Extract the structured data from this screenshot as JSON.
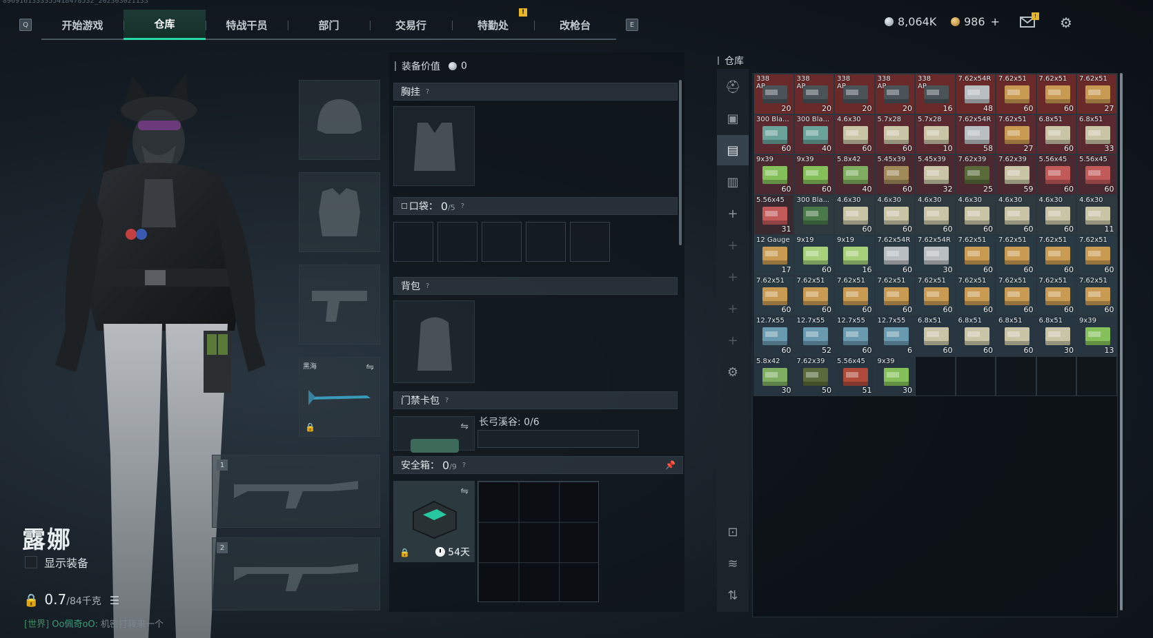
{
  "nav": {
    "key_left": "Q",
    "key_right": "E",
    "tabs": [
      {
        "label": "开始游戏",
        "active": false,
        "alert": false
      },
      {
        "label": "仓库",
        "active": true,
        "alert": false
      },
      {
        "label": "特战干员",
        "active": false,
        "alert": false
      },
      {
        "label": "部门",
        "active": false,
        "alert": false
      },
      {
        "label": "交易行",
        "active": false,
        "alert": false
      },
      {
        "label": "特勤处",
        "active": false,
        "alert": true
      },
      {
        "label": "改枪台",
        "active": false,
        "alert": false
      }
    ],
    "alert_mark": "!"
  },
  "currency": {
    "silver": "8,064K",
    "gold": "986",
    "gold_add": "+"
  },
  "character": {
    "name": "露娜",
    "show_gear_label": "显示装备",
    "weight_current": "0.7",
    "weight_cap": "/84千克"
  },
  "chat": {
    "channel": "[世界]",
    "user": "Oo佩奇oO:",
    "message": "机密打转来一个"
  },
  "gear": {
    "sidearm_name": "黑海",
    "primary_1": "1",
    "primary_2": "2"
  },
  "equipment": {
    "value_label": "装备价值",
    "value": "0",
    "chest_rig": "胸挂",
    "pockets_label": "口袋：",
    "pockets_used": "0",
    "pockets_cap": "/5",
    "backpack": "背包",
    "keycard": "门禁卡包",
    "keycard_info": "长弓溪谷: 0/6",
    "safe_label": "安全箱：",
    "safe_used": "0",
    "safe_cap": "/9",
    "safe_days": "54天",
    "help": "?"
  },
  "warehouse": {
    "title": "仓库",
    "items": [
      {
        "name": "338",
        "sub": "AP",
        "qty": "20",
        "color": "#6a2a2a",
        "box": "#4a5358"
      },
      {
        "name": "338",
        "sub": "AP",
        "qty": "20",
        "color": "#6a2a2a",
        "box": "#4a5358"
      },
      {
        "name": "338",
        "sub": "AP",
        "qty": "20",
        "color": "#6a2a2a",
        "box": "#4a5358"
      },
      {
        "name": "338",
        "sub": "AP",
        "qty": "20",
        "color": "#6a2a2a",
        "box": "#4a5358"
      },
      {
        "name": "338",
        "sub": "AP",
        "qty": "16",
        "color": "#6a2a2a",
        "box": "#4a5358"
      },
      {
        "name": "7.62x54R",
        "sub": "",
        "qty": "48",
        "color": "#6a2a2a",
        "box": "#b9bec2"
      },
      {
        "name": "7.62x51",
        "sub": "",
        "qty": "60",
        "color": "#6a2a2a",
        "box": "#c89a52"
      },
      {
        "name": "7.62x51",
        "sub": "",
        "qty": "60",
        "color": "#6a2a2a",
        "box": "#c89a52"
      },
      {
        "name": "7.62x51",
        "sub": "",
        "qty": "27",
        "color": "#6a2a2a",
        "box": "#c89a52"
      },
      {
        "name": "300 Bla...",
        "sub": "",
        "qty": "60",
        "color": "#5a2a30",
        "box": "#6aa39a"
      },
      {
        "name": "300 Bla...",
        "sub": "",
        "qty": "40",
        "color": "#5a2a30",
        "box": "#6aa39a"
      },
      {
        "name": "4.6x30",
        "sub": "",
        "qty": "60",
        "color": "#5a2a30",
        "box": "#c9c4a6"
      },
      {
        "name": "5.7x28",
        "sub": "",
        "qty": "60",
        "color": "#5a2a30",
        "box": "#c9c4a6"
      },
      {
        "name": "5.7x28",
        "sub": "",
        "qty": "10",
        "color": "#5a2a30",
        "box": "#c9c4a6"
      },
      {
        "name": "7.62x54R",
        "sub": "",
        "qty": "58",
        "color": "#5a2a30",
        "box": "#b9bec2"
      },
      {
        "name": "7.62x51",
        "sub": "",
        "qty": "27",
        "color": "#5a2a30",
        "box": "#c89a52"
      },
      {
        "name": "6.8x51",
        "sub": "",
        "qty": "60",
        "color": "#5a2a30",
        "box": "#c9c4a6"
      },
      {
        "name": "6.8x51",
        "sub": "",
        "qty": "33",
        "color": "#5a2a30",
        "box": "#c9c4a6"
      },
      {
        "name": "9x39",
        "sub": "",
        "qty": "60",
        "color": "#4a2a30",
        "box": "#86c05a"
      },
      {
        "name": "9x39",
        "sub": "",
        "qty": "60",
        "color": "#4a2a30",
        "box": "#86c05a"
      },
      {
        "name": "5.8x42",
        "sub": "",
        "qty": "40",
        "color": "#4a2a30",
        "box": "#7fae62"
      },
      {
        "name": "5.45x39",
        "sub": "",
        "qty": "60",
        "color": "#4a2a30",
        "box": "#a08a5a"
      },
      {
        "name": "5.45x39",
        "sub": "",
        "qty": "32",
        "color": "#4a2a30",
        "box": "#c9c4a6"
      },
      {
        "name": "7.62x39",
        "sub": "",
        "qty": "25",
        "color": "#4a2a30",
        "box": "#5a6a3a"
      },
      {
        "name": "7.62x39",
        "sub": "",
        "qty": "59",
        "color": "#4a2a30",
        "box": "#c9c4a6"
      },
      {
        "name": "5.56x45",
        "sub": "",
        "qty": "60",
        "color": "#4a2a30",
        "box": "#c25a5a"
      },
      {
        "name": "5.56x45",
        "sub": "",
        "qty": "60",
        "color": "#4a2a30",
        "box": "#c25a5a"
      },
      {
        "name": "5.56x45",
        "sub": "",
        "qty": "31",
        "color": "#3a2a30",
        "box": "#c25a5a"
      },
      {
        "name": "300 Bla...",
        "sub": "",
        "qty": "",
        "color": "#2e3a40",
        "box": "#4a7a4a"
      },
      {
        "name": "4.6x30",
        "sub": "",
        "qty": "60",
        "color": "#2e3a40",
        "box": "#c9c4a6"
      },
      {
        "name": "4.6x30",
        "sub": "",
        "qty": "60",
        "color": "#2e3a40",
        "box": "#c9c4a6"
      },
      {
        "name": "4.6x30",
        "sub": "",
        "qty": "60",
        "color": "#2e3a40",
        "box": "#c9c4a6"
      },
      {
        "name": "4.6x30",
        "sub": "",
        "qty": "60",
        "color": "#2e3a40",
        "box": "#c9c4a6"
      },
      {
        "name": "4.6x30",
        "sub": "",
        "qty": "60",
        "color": "#2e3a40",
        "box": "#c9c4a6"
      },
      {
        "name": "4.6x30",
        "sub": "",
        "qty": "60",
        "color": "#2e3a40",
        "box": "#c9c4a6"
      },
      {
        "name": "4.6x30",
        "sub": "",
        "qty": "11",
        "color": "#2e3a40",
        "box": "#c9c4a6"
      },
      {
        "name": "12 Gauge",
        "sub": "",
        "qty": "17",
        "color": "#2a3a44",
        "box": "#c89a52"
      },
      {
        "name": "9x19",
        "sub": "",
        "qty": "60",
        "color": "#2a3a44",
        "box": "#a6d07a"
      },
      {
        "name": "9x19",
        "sub": "",
        "qty": "16",
        "color": "#2a3a44",
        "box": "#a6d07a"
      },
      {
        "name": "7.62x54R",
        "sub": "",
        "qty": "60",
        "color": "#2a3a44",
        "box": "#b9bec2"
      },
      {
        "name": "7.62x54R",
        "sub": "",
        "qty": "30",
        "color": "#2a3a44",
        "box": "#b9bec2"
      },
      {
        "name": "7.62x51",
        "sub": "",
        "qty": "60",
        "color": "#2a3a44",
        "box": "#c89a52"
      },
      {
        "name": "7.62x51",
        "sub": "",
        "qty": "60",
        "color": "#2a3a44",
        "box": "#c89a52"
      },
      {
        "name": "7.62x51",
        "sub": "",
        "qty": "60",
        "color": "#2a3a44",
        "box": "#c89a52"
      },
      {
        "name": "7.62x51",
        "sub": "",
        "qty": "60",
        "color": "#2a3a44",
        "box": "#c89a52"
      },
      {
        "name": "7.62x51",
        "sub": "",
        "qty": "60",
        "color": "#2a3a44",
        "box": "#c89a52"
      },
      {
        "name": "7.62x51",
        "sub": "",
        "qty": "60",
        "color": "#2a3a44",
        "box": "#c89a52"
      },
      {
        "name": "7.62x51",
        "sub": "",
        "qty": "60",
        "color": "#2a3a44",
        "box": "#c89a52"
      },
      {
        "name": "7.62x51",
        "sub": "",
        "qty": "60",
        "color": "#2a3a44",
        "box": "#c89a52"
      },
      {
        "name": "7.62x51",
        "sub": "",
        "qty": "60",
        "color": "#2a3a44",
        "box": "#c89a52"
      },
      {
        "name": "7.62x51",
        "sub": "",
        "qty": "60",
        "color": "#2a3a44",
        "box": "#c89a52"
      },
      {
        "name": "7.62x51",
        "sub": "",
        "qty": "60",
        "color": "#2a3a44",
        "box": "#c89a52"
      },
      {
        "name": "7.62x51",
        "sub": "",
        "qty": "60",
        "color": "#2a3a44",
        "box": "#c89a52"
      },
      {
        "name": "7.62x51",
        "sub": "",
        "qty": "60",
        "color": "#2a3a44",
        "box": "#c89a52"
      },
      {
        "name": "12.7x55",
        "sub": "",
        "qty": "60",
        "color": "#283642",
        "box": "#6a9ab0"
      },
      {
        "name": "12.7x55",
        "sub": "",
        "qty": "52",
        "color": "#283642",
        "box": "#6a9ab0"
      },
      {
        "name": "12.7x55",
        "sub": "",
        "qty": "60",
        "color": "#283642",
        "box": "#6a9ab0"
      },
      {
        "name": "12.7x55",
        "sub": "",
        "qty": "6",
        "color": "#283642",
        "box": "#6a9ab0"
      },
      {
        "name": "6.8x51",
        "sub": "",
        "qty": "60",
        "color": "#283642",
        "box": "#c9c4a6"
      },
      {
        "name": "6.8x51",
        "sub": "",
        "qty": "60",
        "color": "#283642",
        "box": "#c9c4a6"
      },
      {
        "name": "6.8x51",
        "sub": "",
        "qty": "60",
        "color": "#283642",
        "box": "#c9c4a6"
      },
      {
        "name": "6.8x51",
        "sub": "",
        "qty": "30",
        "color": "#283642",
        "box": "#c9c4a6"
      },
      {
        "name": "9x39",
        "sub": "",
        "qty": "13",
        "color": "#283642",
        "box": "#86c05a"
      },
      {
        "name": "5.8x42",
        "sub": "",
        "qty": "30",
        "color": "#263440",
        "box": "#7fae62"
      },
      {
        "name": "7.62x39",
        "sub": "",
        "qty": "50",
        "color": "#263440",
        "box": "#5a6a3a"
      },
      {
        "name": "5.56x45",
        "sub": "",
        "qty": "51",
        "color": "#263440",
        "box": "#b04a3a"
      },
      {
        "name": "9x39",
        "sub": "",
        "qty": "30",
        "color": "#263440",
        "box": "#86c05a"
      }
    ],
    "empty_slots": 5
  }
}
